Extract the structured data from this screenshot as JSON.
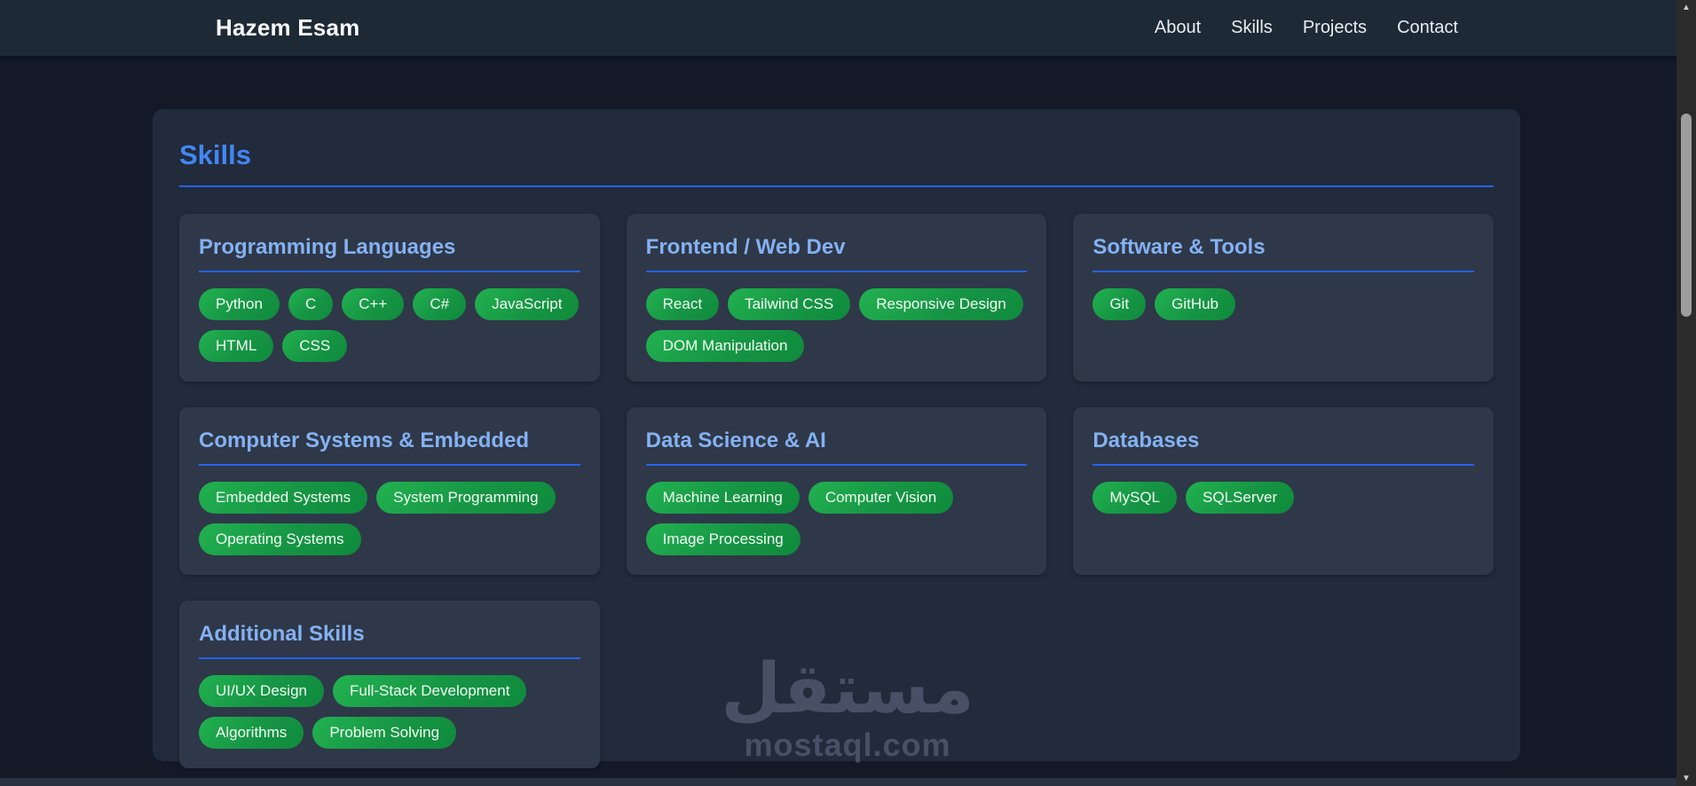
{
  "navbar": {
    "brand": "Hazem Esam",
    "links": [
      "About",
      "Skills",
      "Projects",
      "Contact"
    ]
  },
  "section": {
    "title": "Skills"
  },
  "skill_categories": [
    {
      "title": "Programming Languages",
      "skills": [
        "Python",
        "C",
        "C++",
        "C#",
        "JavaScript",
        "HTML",
        "CSS"
      ]
    },
    {
      "title": "Frontend / Web Dev",
      "skills": [
        "React",
        "Tailwind CSS",
        "Responsive Design",
        "DOM Manipulation"
      ]
    },
    {
      "title": "Software & Tools",
      "skills": [
        "Git",
        "GitHub"
      ]
    },
    {
      "title": "Computer Systems & Embedded",
      "skills": [
        "Embedded Systems",
        "System Programming",
        "Operating Systems"
      ]
    },
    {
      "title": "Data Science & AI",
      "skills": [
        "Machine Learning",
        "Computer Vision",
        "Image Processing"
      ]
    },
    {
      "title": "Databases",
      "skills": [
        "MySQL",
        "SQLServer"
      ]
    },
    {
      "title": "Additional Skills",
      "skills": [
        "UI/UX Design",
        "Full-Stack Development",
        "Algorithms",
        "Problem Solving"
      ]
    }
  ],
  "watermark": {
    "arabic": "مستقل",
    "domain": "mostaql.com"
  },
  "scrollbar": {
    "up_glyph": "▲",
    "down_glyph": "▼"
  },
  "colors": {
    "page_bg": "#131927",
    "navbar_bg": "#1e2936",
    "section_bg": "#212b3b",
    "card_bg": "#2e3848",
    "heading_blue": "#4286f4",
    "card_title_blue": "#85b1f2",
    "underline_blue": "#2563eb",
    "badge_green": "#169544",
    "badge_text": "#f2fff5"
  }
}
